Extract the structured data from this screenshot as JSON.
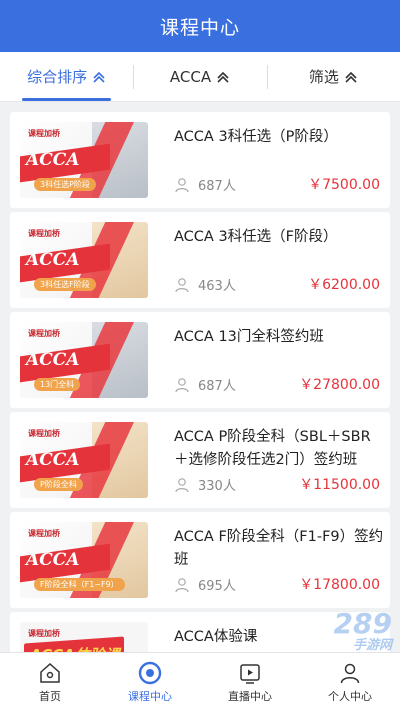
{
  "header": {
    "title": "课程中心"
  },
  "filters": [
    {
      "label": "综合排序",
      "active": true
    },
    {
      "label": "ACCA",
      "active": false
    },
    {
      "label": "筛选",
      "active": false
    }
  ],
  "courses": [
    {
      "title": "ACCA 3科任选（P阶段）",
      "count": "687人",
      "price": "￥7500.00",
      "thumb": {
        "acca": "ACCA",
        "tag": "3科任选P阶段"
      }
    },
    {
      "title": "ACCA 3科任选（F阶段）",
      "count": "463人",
      "price": "￥6200.00",
      "thumb": {
        "acca": "ACCA",
        "tag": "3科任选F阶段"
      }
    },
    {
      "title": "ACCA 13门全科签约班",
      "count": "687人",
      "price": "￥27800.00",
      "thumb": {
        "acca": "ACCA",
        "tag": "13门全科"
      }
    },
    {
      "title": "ACCA P阶段全科（SBL＋SBR＋选修阶段任选2门）签约班",
      "count": "330人",
      "price": "￥11500.00",
      "thumb": {
        "acca": "ACCA",
        "tag": "P阶段全科"
      }
    },
    {
      "title": "ACCA F阶段全科（F1-F9）签约班",
      "count": "695人",
      "price": "￥17800.00",
      "thumb": {
        "acca": "ACCA",
        "tag": "F阶段全科（F1~F9）"
      }
    },
    {
      "title": "ACCA体验课",
      "count": "",
      "price": "",
      "thumb": {
        "acca": "ACCA体验课",
        "tag": ""
      }
    }
  ],
  "nav": [
    {
      "label": "首页",
      "icon": "home-icon",
      "active": false
    },
    {
      "label": "课程中心",
      "icon": "course-icon",
      "active": true
    },
    {
      "label": "直播中心",
      "icon": "live-icon",
      "active": false
    },
    {
      "label": "个人中心",
      "icon": "user-icon",
      "active": false
    }
  ],
  "thumb_brand": "课程加桥",
  "watermark": {
    "main": "289",
    "sub": "手游网"
  },
  "colors": {
    "accent": "#3a6fe0",
    "price": "#e5333b"
  }
}
